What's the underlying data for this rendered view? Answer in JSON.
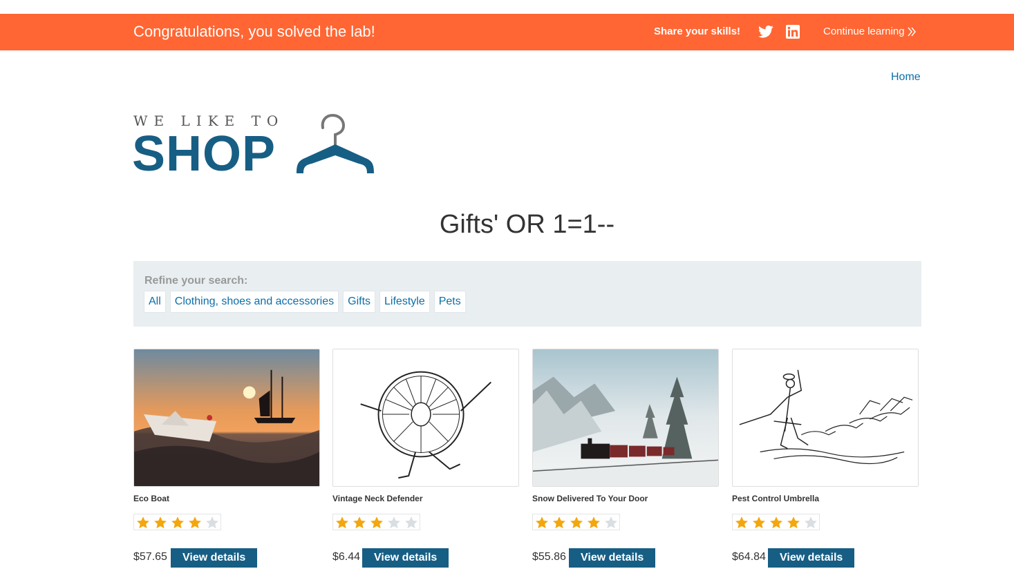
{
  "banner": {
    "title": "Congratulations, you solved the lab!",
    "share_label": "Share your skills!",
    "continue_label": "Continue learning",
    "background_color": "#ff6633"
  },
  "nav": {
    "home_label": "Home"
  },
  "logo": {
    "small_text": "WE LIKE TO",
    "big_text": "SHOP"
  },
  "search": {
    "heading": "Gifts' OR 1=1--"
  },
  "refine": {
    "label": "Refine your search:",
    "filters": [
      "All",
      "Clothing, shoes and accessories",
      "Gifts",
      "Lifestyle",
      "Pets"
    ]
  },
  "products": [
    {
      "name": "Eco Boat",
      "rating": 4,
      "price": "$57.65",
      "button_label": "View details",
      "image_icon": "boat-sunset-image"
    },
    {
      "name": "Vintage Neck Defender",
      "rating": 3,
      "price": "$6.44",
      "button_label": "View details",
      "image_icon": "neck-ruff-illustration"
    },
    {
      "name": "Snow Delivered To Your Door",
      "rating": 4,
      "price": "$55.86",
      "button_label": "View details",
      "image_icon": "snow-train-image"
    },
    {
      "name": "Pest Control Umbrella",
      "rating": 4,
      "price": "$64.84",
      "button_label": "View details",
      "image_icon": "umbrella-cats-illustration"
    }
  ],
  "colors": {
    "accent": "#175e84",
    "link": "#0b6ea8",
    "star_filled": "#f4a60d",
    "star_empty": "#d9dee2"
  }
}
